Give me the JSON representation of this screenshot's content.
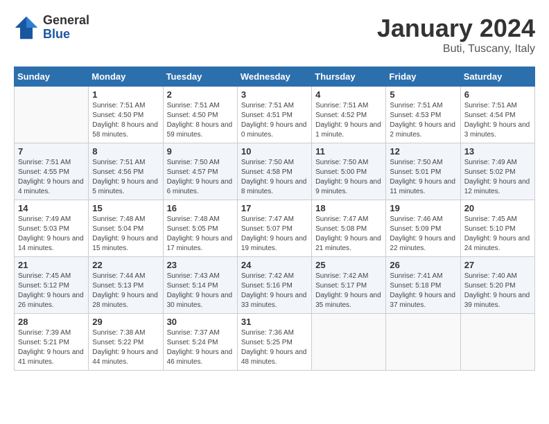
{
  "header": {
    "logo_general": "General",
    "logo_blue": "Blue",
    "month_title": "January 2024",
    "location": "Buti, Tuscany, Italy"
  },
  "days_of_week": [
    "Sunday",
    "Monday",
    "Tuesday",
    "Wednesday",
    "Thursday",
    "Friday",
    "Saturday"
  ],
  "weeks": [
    [
      {
        "day": "",
        "sunrise": "",
        "sunset": "",
        "daylight": ""
      },
      {
        "day": "1",
        "sunrise": "Sunrise: 7:51 AM",
        "sunset": "Sunset: 4:50 PM",
        "daylight": "Daylight: 8 hours and 58 minutes."
      },
      {
        "day": "2",
        "sunrise": "Sunrise: 7:51 AM",
        "sunset": "Sunset: 4:50 PM",
        "daylight": "Daylight: 8 hours and 59 minutes."
      },
      {
        "day": "3",
        "sunrise": "Sunrise: 7:51 AM",
        "sunset": "Sunset: 4:51 PM",
        "daylight": "Daylight: 9 hours and 0 minutes."
      },
      {
        "day": "4",
        "sunrise": "Sunrise: 7:51 AM",
        "sunset": "Sunset: 4:52 PM",
        "daylight": "Daylight: 9 hours and 1 minute."
      },
      {
        "day": "5",
        "sunrise": "Sunrise: 7:51 AM",
        "sunset": "Sunset: 4:53 PM",
        "daylight": "Daylight: 9 hours and 2 minutes."
      },
      {
        "day": "6",
        "sunrise": "Sunrise: 7:51 AM",
        "sunset": "Sunset: 4:54 PM",
        "daylight": "Daylight: 9 hours and 3 minutes."
      }
    ],
    [
      {
        "day": "7",
        "sunrise": "Sunrise: 7:51 AM",
        "sunset": "Sunset: 4:55 PM",
        "daylight": "Daylight: 9 hours and 4 minutes."
      },
      {
        "day": "8",
        "sunrise": "Sunrise: 7:51 AM",
        "sunset": "Sunset: 4:56 PM",
        "daylight": "Daylight: 9 hours and 5 minutes."
      },
      {
        "day": "9",
        "sunrise": "Sunrise: 7:50 AM",
        "sunset": "Sunset: 4:57 PM",
        "daylight": "Daylight: 9 hours and 6 minutes."
      },
      {
        "day": "10",
        "sunrise": "Sunrise: 7:50 AM",
        "sunset": "Sunset: 4:58 PM",
        "daylight": "Daylight: 9 hours and 8 minutes."
      },
      {
        "day": "11",
        "sunrise": "Sunrise: 7:50 AM",
        "sunset": "Sunset: 5:00 PM",
        "daylight": "Daylight: 9 hours and 9 minutes."
      },
      {
        "day": "12",
        "sunrise": "Sunrise: 7:50 AM",
        "sunset": "Sunset: 5:01 PM",
        "daylight": "Daylight: 9 hours and 11 minutes."
      },
      {
        "day": "13",
        "sunrise": "Sunrise: 7:49 AM",
        "sunset": "Sunset: 5:02 PM",
        "daylight": "Daylight: 9 hours and 12 minutes."
      }
    ],
    [
      {
        "day": "14",
        "sunrise": "Sunrise: 7:49 AM",
        "sunset": "Sunset: 5:03 PM",
        "daylight": "Daylight: 9 hours and 14 minutes."
      },
      {
        "day": "15",
        "sunrise": "Sunrise: 7:48 AM",
        "sunset": "Sunset: 5:04 PM",
        "daylight": "Daylight: 9 hours and 15 minutes."
      },
      {
        "day": "16",
        "sunrise": "Sunrise: 7:48 AM",
        "sunset": "Sunset: 5:05 PM",
        "daylight": "Daylight: 9 hours and 17 minutes."
      },
      {
        "day": "17",
        "sunrise": "Sunrise: 7:47 AM",
        "sunset": "Sunset: 5:07 PM",
        "daylight": "Daylight: 9 hours and 19 minutes."
      },
      {
        "day": "18",
        "sunrise": "Sunrise: 7:47 AM",
        "sunset": "Sunset: 5:08 PM",
        "daylight": "Daylight: 9 hours and 21 minutes."
      },
      {
        "day": "19",
        "sunrise": "Sunrise: 7:46 AM",
        "sunset": "Sunset: 5:09 PM",
        "daylight": "Daylight: 9 hours and 22 minutes."
      },
      {
        "day": "20",
        "sunrise": "Sunrise: 7:45 AM",
        "sunset": "Sunset: 5:10 PM",
        "daylight": "Daylight: 9 hours and 24 minutes."
      }
    ],
    [
      {
        "day": "21",
        "sunrise": "Sunrise: 7:45 AM",
        "sunset": "Sunset: 5:12 PM",
        "daylight": "Daylight: 9 hours and 26 minutes."
      },
      {
        "day": "22",
        "sunrise": "Sunrise: 7:44 AM",
        "sunset": "Sunset: 5:13 PM",
        "daylight": "Daylight: 9 hours and 28 minutes."
      },
      {
        "day": "23",
        "sunrise": "Sunrise: 7:43 AM",
        "sunset": "Sunset: 5:14 PM",
        "daylight": "Daylight: 9 hours and 30 minutes."
      },
      {
        "day": "24",
        "sunrise": "Sunrise: 7:42 AM",
        "sunset": "Sunset: 5:16 PM",
        "daylight": "Daylight: 9 hours and 33 minutes."
      },
      {
        "day": "25",
        "sunrise": "Sunrise: 7:42 AM",
        "sunset": "Sunset: 5:17 PM",
        "daylight": "Daylight: 9 hours and 35 minutes."
      },
      {
        "day": "26",
        "sunrise": "Sunrise: 7:41 AM",
        "sunset": "Sunset: 5:18 PM",
        "daylight": "Daylight: 9 hours and 37 minutes."
      },
      {
        "day": "27",
        "sunrise": "Sunrise: 7:40 AM",
        "sunset": "Sunset: 5:20 PM",
        "daylight": "Daylight: 9 hours and 39 minutes."
      }
    ],
    [
      {
        "day": "28",
        "sunrise": "Sunrise: 7:39 AM",
        "sunset": "Sunset: 5:21 PM",
        "daylight": "Daylight: 9 hours and 41 minutes."
      },
      {
        "day": "29",
        "sunrise": "Sunrise: 7:38 AM",
        "sunset": "Sunset: 5:22 PM",
        "daylight": "Daylight: 9 hours and 44 minutes."
      },
      {
        "day": "30",
        "sunrise": "Sunrise: 7:37 AM",
        "sunset": "Sunset: 5:24 PM",
        "daylight": "Daylight: 9 hours and 46 minutes."
      },
      {
        "day": "31",
        "sunrise": "Sunrise: 7:36 AM",
        "sunset": "Sunset: 5:25 PM",
        "daylight": "Daylight: 9 hours and 48 minutes."
      },
      {
        "day": "",
        "sunrise": "",
        "sunset": "",
        "daylight": ""
      },
      {
        "day": "",
        "sunrise": "",
        "sunset": "",
        "daylight": ""
      },
      {
        "day": "",
        "sunrise": "",
        "sunset": "",
        "daylight": ""
      }
    ]
  ]
}
